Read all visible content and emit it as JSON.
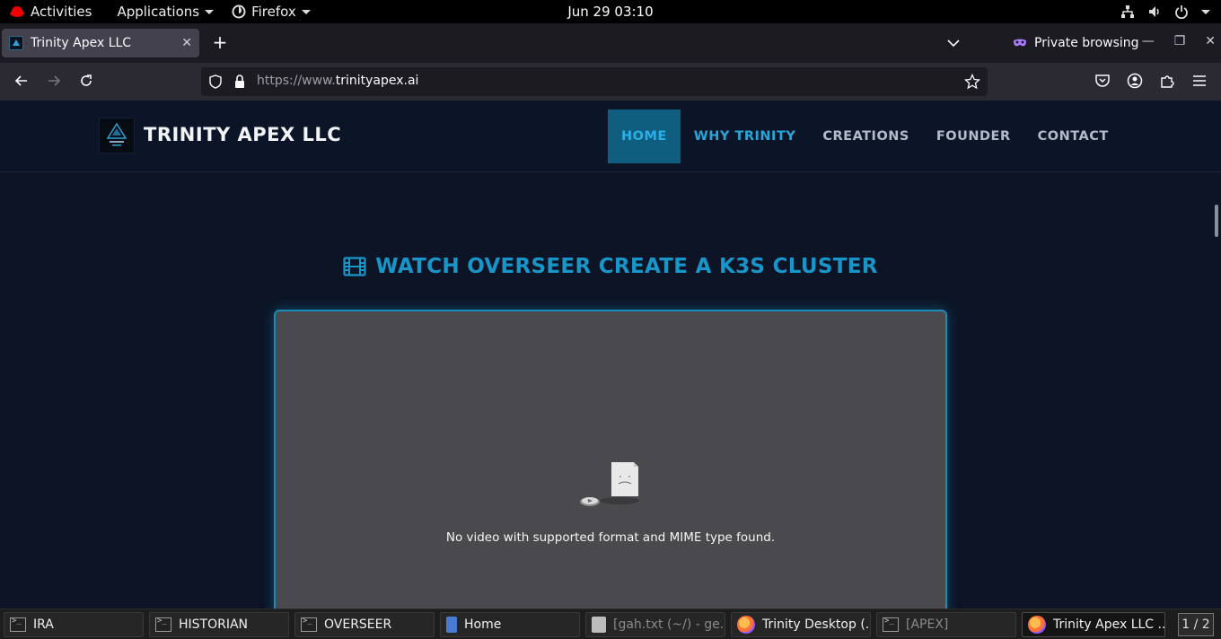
{
  "gnome": {
    "activities": "Activities",
    "applications": "Applications",
    "firefox_menu": "Firefox",
    "clock": "Jun 29  03:10"
  },
  "browser": {
    "tab_title": "Trinity Apex LLC",
    "private_label": "Private browsing",
    "url_prefix": "https://www.",
    "url_domain": "trinityapex.ai"
  },
  "site": {
    "brand": "TRINITY APEX LLC",
    "nav": [
      {
        "label": "HOME",
        "active": true
      },
      {
        "label": "WHY TRINITY",
        "active": false
      },
      {
        "label": "CREATIONS",
        "active": false
      },
      {
        "label": "FOUNDER",
        "active": false
      },
      {
        "label": "CONTACT",
        "active": false
      }
    ],
    "section_title": "WATCH OVERSEER CREATE A K3S CLUSTER",
    "video_message": "No video with supported format and MIME type found.",
    "accent_color": "#1996c9"
  },
  "taskbar": {
    "tasks": [
      {
        "label": "IRA",
        "icon": "terminal-icon"
      },
      {
        "label": "HISTORIAN",
        "icon": "terminal-icon"
      },
      {
        "label": "OVERSEER",
        "icon": "terminal-icon"
      },
      {
        "label": "Home",
        "icon": "file-manager-icon"
      },
      {
        "label": "[gah.txt (~/) - ge...",
        "icon": "text-editor-icon"
      },
      {
        "label": "Trinity Desktop (...",
        "icon": "firefox-icon"
      },
      {
        "label": "[APEX]",
        "icon": "terminal-icon"
      },
      {
        "label": "Trinity Apex LLC ...",
        "icon": "firefox-icon"
      }
    ],
    "workspace": "1 / 2"
  }
}
